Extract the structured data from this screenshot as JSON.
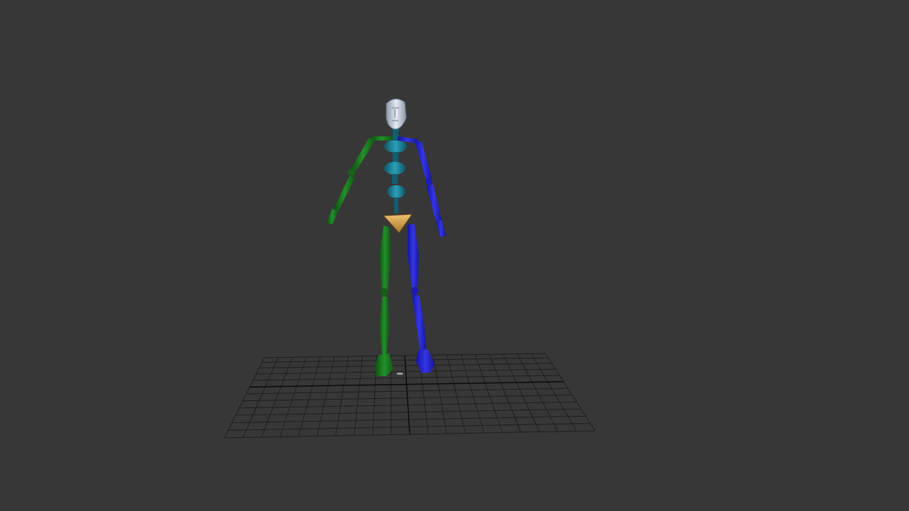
{
  "viewport": {
    "background_color": "#373737",
    "grid_color": "#1e1e1e",
    "grid_axis_color": "#0a0a0a"
  },
  "figure": {
    "left_side_color": "#1e7a1e",
    "right_side_color": "#2525c8",
    "spine_color": "#1f8ca0",
    "pelvis_color": "#d9a64a",
    "head_color": "#c8d0dc"
  }
}
